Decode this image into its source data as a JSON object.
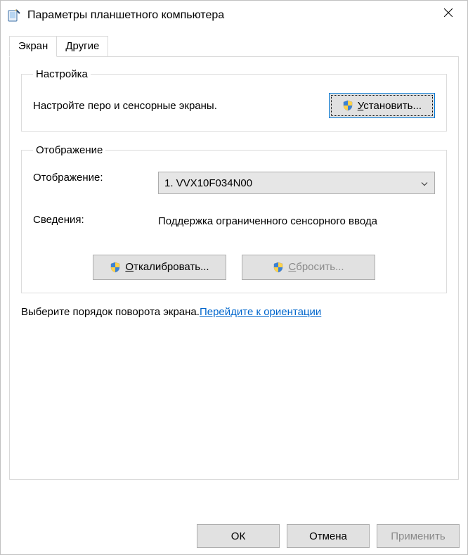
{
  "window": {
    "title": "Параметры планшетного компьютера"
  },
  "tabs": {
    "screen": "Экран",
    "other": "Другие"
  },
  "setup": {
    "legend": "Настройка",
    "text": "Настройте перо и сенсорные экраны.",
    "button": "Установить..."
  },
  "display": {
    "legend": "Отображение",
    "label_display": "Отображение:",
    "select_value": "1. VVX10F034N00",
    "label_info": "Сведения:",
    "info_value": "Поддержка ограниченного сенсорного ввода",
    "btn_calibrate": "Откалибровать...",
    "btn_reset": "Сбросить..."
  },
  "orientation": {
    "text": "Выберите порядок поворота экрана.",
    "link": "Перейдите к ориентации"
  },
  "footer": {
    "ok": "ОК",
    "cancel": "Отмена",
    "apply": "Применить"
  }
}
